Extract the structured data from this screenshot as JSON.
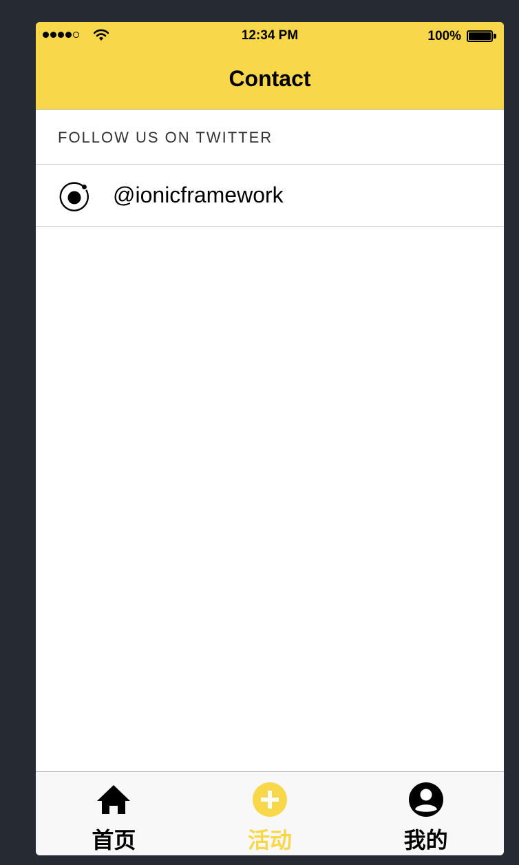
{
  "status_bar": {
    "time": "12:34 PM",
    "battery": "100%"
  },
  "nav": {
    "title": "Contact"
  },
  "section": {
    "header": "FOLLOW US ON TWITTER"
  },
  "list": {
    "items": [
      {
        "label": "@ionicframework",
        "icon": "ionic-logo-icon"
      }
    ]
  },
  "tabs": {
    "items": [
      {
        "label": "首页",
        "icon": "home-icon",
        "active": false
      },
      {
        "label": "活动",
        "icon": "add-circle-icon",
        "active": true
      },
      {
        "label": "我的",
        "icon": "person-circle-icon",
        "active": false
      }
    ]
  },
  "colors": {
    "accent": "#f9d74a",
    "background": "#262a33",
    "tabbar": "#f8f8f8"
  }
}
